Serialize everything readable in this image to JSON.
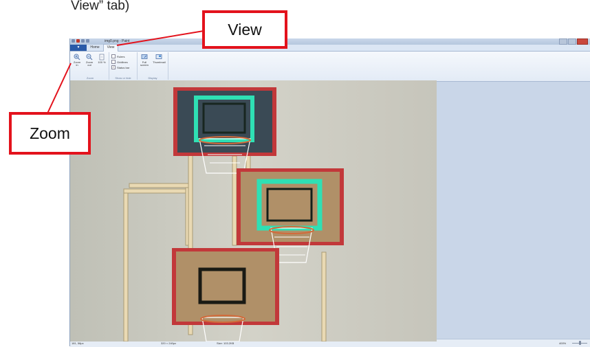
{
  "caption_fragment": "View” tab)",
  "app": {
    "document_title": "img0.png - Paint",
    "tabs": {
      "file": "▼",
      "home": "Home",
      "view": "View"
    },
    "ribbon": {
      "zoom_group": {
        "label": "Zoom",
        "zoom_in": "Zoom in",
        "zoom_out": "Zoom out",
        "hundred_percent": "100 %"
      },
      "show_or_hide_group": {
        "label": "Show or hide",
        "rulers": "Rulers",
        "gridlines": "Gridlines",
        "status_bar": "Status bar",
        "status_bar_checked": true
      },
      "display_group": {
        "label": "Display",
        "full_screen": "Full screen",
        "thumbnail": "Thumbnail"
      }
    },
    "statusbar": {
      "cursor_position": "181, 58px",
      "selection_size": "",
      "image_dimensions": "320 × 240px",
      "file_size": "Size: 103.2KB",
      "zoom_level": "400%"
    }
  },
  "annotations": {
    "view_callout": "View",
    "zoom_callout": "Zoom",
    "callout_color": "#e3121c"
  },
  "colors": {
    "photo_wall": "#c9c8be",
    "backboard_frame": "#c2383a",
    "backboard_wood": "#b09068",
    "glow_green": "#2fe0b4"
  }
}
